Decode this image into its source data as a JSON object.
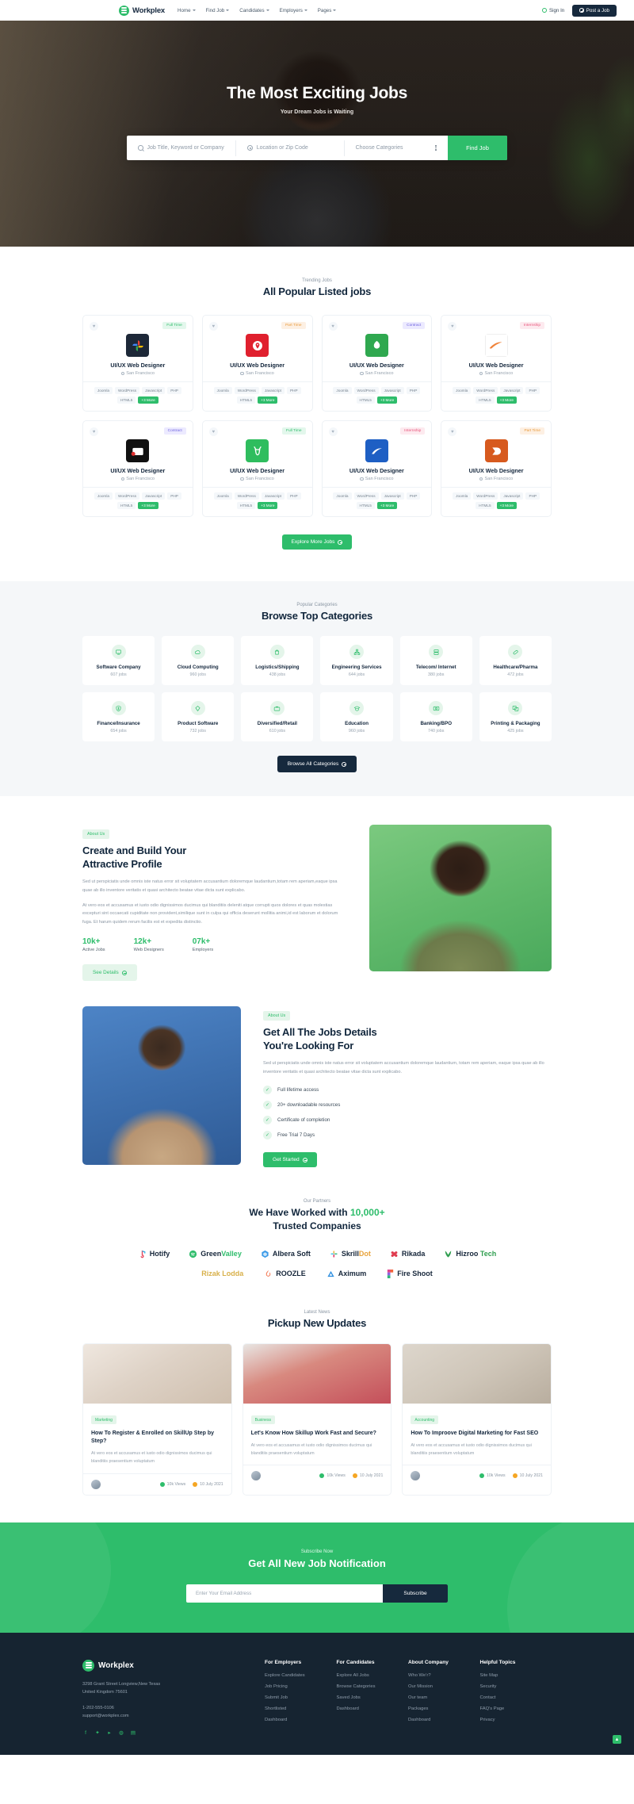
{
  "header": {
    "brand": "Workplex",
    "nav": [
      {
        "label": "Home"
      },
      {
        "label": "Find Job"
      },
      {
        "label": "Candidates"
      },
      {
        "label": "Employers"
      },
      {
        "label": "Pages"
      }
    ],
    "sign_in": "Sign In",
    "post_job": "Post a Job"
  },
  "hero": {
    "title": "The Most Exciting Jobs",
    "subtitle": "Your Dream Jobs is Waiting",
    "search": {
      "keyword_placeholder": "Job Title, Keyword or Company",
      "location_placeholder": "Location or Zip Code",
      "category_placeholder": "Choose Categories",
      "button": "Find Job"
    }
  },
  "jobs": {
    "eyebrow": "Trending Jobs",
    "title": "All Popular Listed jobs",
    "tags": [
      "Joomla",
      "WordPress",
      "Javascript",
      "PHP",
      "HTML5"
    ],
    "more_tag": "+3 More",
    "explore_button": "Explore More Jobs",
    "items": [
      {
        "title": "UI/UX Web Designer",
        "location": "San Francisco",
        "badge": "Full Time",
        "badge_type": "b-full",
        "logo": "google-photos-icon"
      },
      {
        "title": "UI/UX Web Designer",
        "location": "San Francisco",
        "badge": "Part Time",
        "badge_type": "b-part",
        "logo": "pin-drop-icon"
      },
      {
        "title": "UI/UX Web Designer",
        "location": "San Francisco",
        "badge": "Contract",
        "badge_type": "b-contract",
        "logo": "leaf-icon"
      },
      {
        "title": "UI/UX Web Designer",
        "location": "San Francisco",
        "badge": "Internship",
        "badge_type": "b-intern",
        "logo": "swoosh-icon"
      },
      {
        "title": "UI/UX Web Designer",
        "location": "San Francisco",
        "badge": "Contract",
        "badge_type": "b-contract",
        "logo": "camera-icon"
      },
      {
        "title": "UI/UX Web Designer",
        "location": "San Francisco",
        "badge": "Full Time",
        "badge_type": "b-full",
        "logo": "deer-icon"
      },
      {
        "title": "UI/UX Web Designer",
        "location": "San Francisco",
        "badge": "Internship",
        "badge_type": "b-intern",
        "logo": "blue-wave-icon"
      },
      {
        "title": "UI/UX Web Designer",
        "location": "San Francisco",
        "badge": "Part Time",
        "badge_type": "b-part",
        "logo": "orange-d-icon"
      }
    ]
  },
  "categories": {
    "eyebrow": "Popular Categories",
    "title": "Browse Top Categories",
    "button": "Browse All Categories",
    "items": [
      {
        "name": "Software Company",
        "jobs": "607 jobs",
        "icon": "monitor-icon"
      },
      {
        "name": "Cloud Computing",
        "jobs": "960 jobs",
        "icon": "cloud-icon"
      },
      {
        "name": "Logistics/Shipping",
        "jobs": "438 jobs",
        "icon": "shipping-bag-icon"
      },
      {
        "name": "Engineering Services",
        "jobs": "644 jobs",
        "icon": "sitemap-icon"
      },
      {
        "name": "Telecom/ Internet",
        "jobs": "380 jobs",
        "icon": "server-icon"
      },
      {
        "name": "Healthcare/Pharma",
        "jobs": "472 jobs",
        "icon": "capsule-icon"
      },
      {
        "name": "Finance/Insurance",
        "jobs": "654 jobs",
        "icon": "shield-dollar-icon"
      },
      {
        "name": "Product Software",
        "jobs": "732 jobs",
        "icon": "diamond-icon"
      },
      {
        "name": "Diversified/Retail",
        "jobs": "610 jobs",
        "icon": "briefcase-icon"
      },
      {
        "name": "Education",
        "jobs": "960 jobs",
        "icon": "graduation-icon"
      },
      {
        "name": "Banking/BPO",
        "jobs": "740 jobs",
        "icon": "bank-card-icon"
      },
      {
        "name": "Printing & Packaging",
        "jobs": "425 jobs",
        "icon": "package-icon"
      }
    ]
  },
  "about": {
    "pill": "About Us",
    "title_line1": "Create and Build Your",
    "title_line2": "Attractive Profile",
    "para1": "Sed ut perspiciatis unde omnis iste natus error sit voluptatem accusantium doloremque laudantium,totam rem aperiam,eaque ipsa quae ab illo inventore veritatis et quasi architecto beatae vitae dicta sunt explicabo.",
    "para2": "At vero eos et accusamus et iusto odio dignissimos ducimus qui blanditiis deleniti atque corrupti quos dolores et quas molestias excepturi sint occaecati cupiditate non provident,similique sunt in culpa qui officia deserunt mollitia animi,id est laborum et dolorum fuga. Et harum quidem rerum facilis est et expedita distinctio.",
    "stats": [
      {
        "num": "10k+",
        "label": "Active Jobs"
      },
      {
        "num": "12k+",
        "label": "Web Designers"
      },
      {
        "num": "07k+",
        "label": "Employers"
      }
    ],
    "button": "See Details"
  },
  "details": {
    "pill": "About Us",
    "title_line1": "Get All The Jobs Details",
    "title_line2": "You're Looking For",
    "para": "Sed ut perspiciatis unde omnis iste natus error sit voluptatem accusantium doloremque laudantium, totam rem aperiam, eaque ipsa quae ab illo inventore veritatis et quasi architecto beatae vitae dicta sunt explicabo.",
    "checks": [
      "Full lifetime access",
      "20+ downloadable resources",
      "Certificate of completion",
      "Free Trial 7 Days"
    ],
    "button": "Get Started"
  },
  "partners": {
    "eyebrow": "Our Partners",
    "title_pre": "We Have Worked with ",
    "title_accent": "10,000+",
    "title_post": "Trusted Companies",
    "row1": [
      {
        "name": "Hotify",
        "accent": "",
        "color": "#e8455b",
        "icon": "music-note-icon"
      },
      {
        "name": "Green",
        "accent": "Valley",
        "color": "#2ebd6b",
        "icon": "spotify-icon"
      },
      {
        "name": "Albera Soft",
        "accent": "",
        "color": "#3b9ae8",
        "icon": "hexagon-icon"
      },
      {
        "name": "Skrill",
        "accent": "Dot",
        "color": "#e8a33b",
        "icon": "slack-icon"
      },
      {
        "name": "Rikada",
        "accent": "",
        "color": "#e03a4e",
        "icon": "blossom-icon"
      },
      {
        "name": "Hizroo ",
        "accent": "Tech",
        "color": "#2f9e4f",
        "icon": "leaf-v-icon"
      }
    ],
    "row2": [
      {
        "name": "Rizak Lodda",
        "accent": "",
        "color": "#d8b04a",
        "icon": "text-logo"
      },
      {
        "name": "ROOZLE",
        "accent": "",
        "color": "#f2663c",
        "icon": "flame-icon"
      },
      {
        "name": "Aximum",
        "accent": "",
        "color": "#2f8fe0",
        "icon": "triangle-icon"
      },
      {
        "name": "Fire Shoot",
        "accent": "",
        "color": "#e0478f",
        "icon": "figma-icon"
      }
    ]
  },
  "blog": {
    "eyebrow": "Latest News",
    "title": "Pickup New Updates",
    "posts": [
      {
        "category": "Marketing",
        "title": "How To Register & Enrolled on SkillUp Step by Step?",
        "excerpt": "At vero eos et accusamus et iusto odio dignissimos ducimus qui blanditiis praesentium voluptatum",
        "views": "10k Views",
        "date": "10 July 2021"
      },
      {
        "category": "Business",
        "title": "Let's Know How Skillup Work Fast and Secure?",
        "excerpt": "At vero eos et accusamus et iusto odio dignissimos ducimus qui blanditiis praesentium voluptatum",
        "views": "10k Views",
        "date": "10 July 2021"
      },
      {
        "category": "Accounting",
        "title": "How To Improove Digital Marketing for Fast SEO",
        "excerpt": "At vero eos et accusamus et iusto odio dignissimos ducimus qui blanditiis praesentium voluptatum",
        "views": "10k Views",
        "date": "10 July 2021"
      }
    ]
  },
  "newsletter": {
    "eyebrow": "Subscribe Now",
    "title": "Get All New Job Notification",
    "placeholder": "Enter Your Email Address",
    "button": "Subscribe"
  },
  "footer": {
    "brand": "Workplex",
    "address_line1": "3298 Grant Street Longview,New Texas",
    "address_line2": "United Kingdom 75601",
    "phone": "1-202-555-0106",
    "email": "support@workplex.com",
    "socials": [
      "facebook-icon",
      "twitter-icon",
      "youtube-icon",
      "whatsapp-icon",
      "linkedin-icon"
    ],
    "columns": [
      {
        "heading": "For Employers",
        "links": [
          "Explore Candidates",
          "Job Pricing",
          "Submit Job",
          "Shortlisted",
          "Dashboard"
        ]
      },
      {
        "heading": "For Candidates",
        "links": [
          "Explore All Jobs",
          "Browse Categories",
          "Saved Jobs",
          "Dashboard"
        ]
      },
      {
        "heading": "About Company",
        "links": [
          "Who We’r?",
          "Our Mission",
          "Our team",
          "Packages",
          "Dashboard"
        ]
      },
      {
        "heading": "Helpful Topics",
        "links": [
          "Site Map",
          "Security",
          "Contact",
          "FAQ's Page",
          "Privacy"
        ]
      }
    ]
  },
  "colors": {
    "primary": "#2ebd6b",
    "dark": "#16293d",
    "footer_bg": "#162431"
  }
}
